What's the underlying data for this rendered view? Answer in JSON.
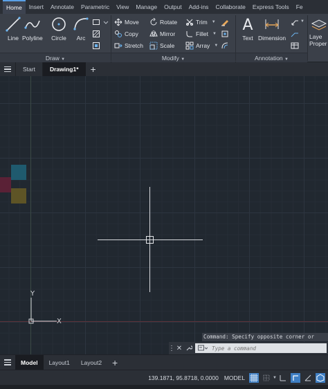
{
  "ribbon": {
    "tabs": [
      "Home",
      "Insert",
      "Annotate",
      "Parametric",
      "View",
      "Manage",
      "Output",
      "Add-ins",
      "Collaborate",
      "Express Tools",
      "Fe"
    ],
    "active_tab": "Home",
    "draw": {
      "label": "Draw",
      "line": "Line",
      "polyline": "Polyline",
      "circle": "Circle",
      "arc": "Arc"
    },
    "modify": {
      "label": "Modify",
      "move": "Move",
      "rotate": "Rotate",
      "trim": "Trim",
      "copy": "Copy",
      "mirror": "Mirror",
      "fillet": "Fillet",
      "stretch": "Stretch",
      "scale": "Scale",
      "array": "Array"
    },
    "annotation": {
      "label": "Annotation",
      "text": "Text",
      "dimension": "Dimension"
    },
    "layers": {
      "label_line1": "Laye",
      "label_line2": "Proper"
    }
  },
  "file_tabs": {
    "start": "Start",
    "drawing": "Drawing1*"
  },
  "ucs": {
    "x_label": "X",
    "y_label": "Y"
  },
  "command": {
    "history": "Command: Specify opposite corner or",
    "placeholder": "Type a command"
  },
  "layout_tabs": [
    "Model",
    "Layout1",
    "Layout2"
  ],
  "status": {
    "coordinates": "139.1871, 95.8718, 0.0000",
    "space": "MODEL"
  },
  "colors": {
    "canvas_bg": "#212830",
    "crosshair": "#d6d8dc",
    "accent": "#5aa0e6",
    "swatch_cyan": "#1f5a6e",
    "swatch_magenta": "#5a2136",
    "swatch_yellow": "#5e5426"
  }
}
